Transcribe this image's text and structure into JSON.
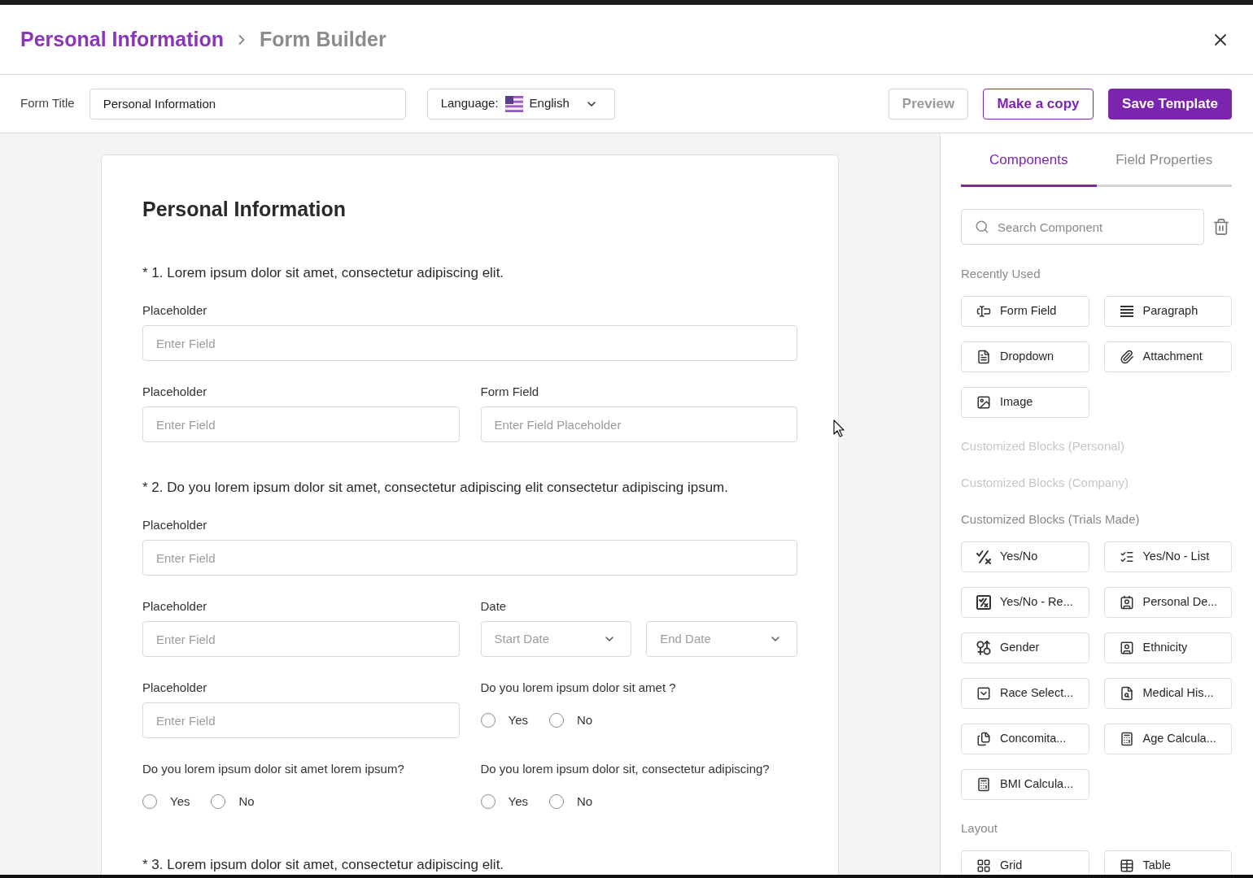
{
  "header": {
    "breadcrumb": [
      {
        "label": "Personal Information",
        "current": false
      },
      {
        "label": "Form Builder",
        "current": true
      }
    ]
  },
  "toolbar": {
    "form_title": {
      "label": "Form Title",
      "value": "Personal Information"
    },
    "language": {
      "label": "Language:",
      "value": "English"
    },
    "buttons": [
      {
        "label": "Preview",
        "kind": "secondary"
      },
      {
        "label": "Make a copy",
        "kind": "outline"
      },
      {
        "label": "Save Template",
        "kind": "primary"
      }
    ]
  },
  "form": {
    "title": "Personal Information",
    "sections": [
      {
        "question": "* 1. Lorem ipsum dolor sit amet, consectetur adipiscing elit.",
        "rows": [
          [
            {
              "kind": "text",
              "label": "Placeholder",
              "placeholder": "Enter Field"
            }
          ],
          [
            {
              "kind": "text",
              "label": "Placeholder",
              "placeholder": "Enter Field"
            },
            {
              "kind": "text",
              "label": "Form Field",
              "placeholder": "Enter Field Placeholder"
            }
          ]
        ]
      },
      {
        "question": "* 2. Do you lorem ipsum dolor sit amet, consectetur adipiscing elit consectetur adipiscing ipsum.",
        "rows": [
          [
            {
              "kind": "text",
              "label": "Placeholder",
              "placeholder": "Enter Field"
            }
          ],
          [
            {
              "kind": "text",
              "label": "Placeholder",
              "placeholder": "Enter Field"
            },
            {
              "kind": "date_range",
              "label": "Date",
              "start": {
                "placeholder": "Start Date"
              },
              "end": {
                "placeholder": "End Date"
              }
            }
          ],
          [
            {
              "kind": "text",
              "label": "Placeholder",
              "placeholder": "Enter Field"
            },
            {
              "kind": "radio",
              "label": "Do you lorem ipsum dolor sit amet ?",
              "options": [
                {
                  "label": "Yes",
                  "selected": false
                },
                {
                  "label": "No",
                  "selected": false
                }
              ]
            }
          ],
          [
            {
              "kind": "radio",
              "label": "Do you lorem ipsum dolor sit amet lorem ipsum?",
              "options": [
                {
                  "label": "Yes",
                  "selected": false
                },
                {
                  "label": "No",
                  "selected": false
                }
              ]
            },
            {
              "kind": "radio",
              "label": "Do you lorem ipsum dolor sit, consectetur adipiscing?",
              "options": [
                {
                  "label": "Yes",
                  "selected": false
                },
                {
                  "label": "No",
                  "selected": false
                }
              ]
            }
          ]
        ]
      },
      {
        "question": "* 3. Lorem ipsum dolor sit amet, consectetur adipiscing elit."
      }
    ]
  },
  "panel": {
    "tabs": [
      {
        "label": "Components",
        "selected": true
      },
      {
        "label": "Field Properties",
        "selected": false
      }
    ],
    "search": {
      "placeholder": "Search Component"
    },
    "groups": [
      {
        "title": "Recently Used",
        "disabled": false,
        "items": [
          "Form Field",
          "Paragraph",
          "Dropdown",
          "Attachment",
          "Image"
        ]
      },
      {
        "title": "Customized Blocks (Personal)",
        "disabled": true
      },
      {
        "title": "Customized Blocks (Company)",
        "disabled": true
      },
      {
        "title": "Customized Blocks (Trials Made)",
        "disabled": false,
        "items": [
          "Yes/No",
          "Yes/No - List",
          "Yes/No - Re...",
          "Personal De...",
          "Gender",
          "Ethnicity",
          "Race Select...",
          "Medical His...",
          "Concomita...",
          "Age Calcula...",
          "BMI Calcula..."
        ]
      },
      {
        "title": "Layout",
        "disabled": false,
        "items": [
          "Grid",
          "Table"
        ]
      }
    ]
  }
}
